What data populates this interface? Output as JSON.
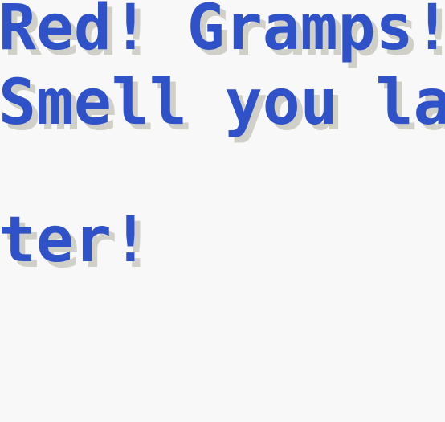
{
  "dialogue": {
    "lines": [
      "Red! Gramps!",
      "Smell you la",
      "ter!"
    ]
  },
  "colors": {
    "text": "#2f52c8",
    "shadow": "#d0d0c8",
    "background": "#f8f8f8"
  }
}
